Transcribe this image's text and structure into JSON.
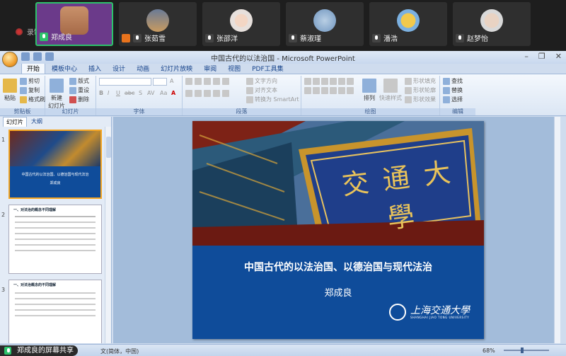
{
  "meeting": {
    "recording_label": "录制中",
    "participants": [
      {
        "name": "郑成良",
        "mic": "on",
        "active": true
      },
      {
        "name": "张茹雪",
        "mic": "off",
        "host": true
      },
      {
        "name": "张邵洋",
        "mic": "off"
      },
      {
        "name": "蔡淑瑾",
        "mic": "off"
      },
      {
        "name": "潘浩",
        "mic": "off"
      },
      {
        "name": "赵梦怡",
        "mic": "off"
      }
    ],
    "share_banner": "郑成良的屏幕共享"
  },
  "ppt": {
    "title": "中国古代的以法治国 - Microsoft PowerPoint",
    "tabs": [
      "开始",
      "模板中心",
      "插入",
      "设计",
      "动画",
      "幻灯片放映",
      "审阅",
      "视图",
      "PDF工具集"
    ],
    "active_tab": "开始",
    "ribbon": {
      "clipboard": {
        "label": "剪贴板",
        "paste": "粘贴",
        "cut": "剪切",
        "copy": "复制",
        "format_painter": "格式刷"
      },
      "slides": {
        "label": "幻灯片",
        "new_slide": "新建\n幻灯片",
        "layout": "版式",
        "reset": "重设",
        "delete": "删除"
      },
      "font": {
        "label": "字体",
        "bold": "B",
        "italic": "I",
        "underline": "U",
        "abc": "abc",
        "s": "S",
        "av": "AV",
        "aa": "Aa",
        "a": "A"
      },
      "paragraph": {
        "label": "段落",
        "text_direction": "文字方向",
        "align_text": "对齐文本",
        "smartart": "转换为 SmartArt"
      },
      "drawing": {
        "label": "绘图",
        "arrange": "排列",
        "quick_styles": "快速样式",
        "fill": "形状填充",
        "outline": "形状轮廓",
        "effects": "形状效果"
      },
      "editing": {
        "label": "编辑",
        "find": "查找",
        "replace": "替换",
        "select": "选择"
      }
    },
    "left_panel": {
      "tabs": [
        "幻灯片",
        "大纲"
      ],
      "slides": [
        {
          "num": "1",
          "title": "中国古代的以法治国、以德治国与现代法治",
          "author": "郑成良"
        },
        {
          "num": "2",
          "heading": "一、对法治的概念不同理解"
        },
        {
          "num": "3",
          "heading": "一、对法治概念的不同理解"
        }
      ]
    },
    "slide": {
      "title": "中国古代的以法治国、以德治国与现代法治",
      "author": "郑成良",
      "plaque_text": "交 通 大 學",
      "logo_text": "上海交通大學",
      "logo_sub": "SHANGHAI JIAO TONG UNIVERSITY"
    },
    "status": {
      "language": "文(简体，中国)",
      "zoom": "68%"
    }
  }
}
